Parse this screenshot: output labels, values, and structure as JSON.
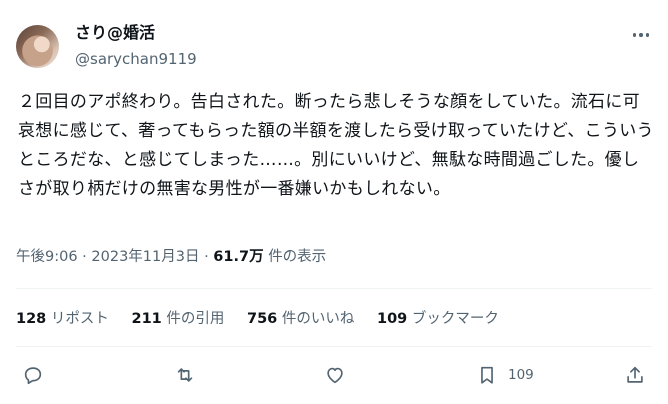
{
  "user": {
    "display_name": "さり@婚活",
    "handle": "@sarychan9119"
  },
  "tweet": {
    "text": "２回目のアポ終わり。告白された。断ったら悲しそうな顔をしていた。流石に可哀想に感じて、奢ってもらった額の半額を渡したら受け取っていたけど、こういうところだな、と感じてしまった……。別にいいけど、無駄な時間過ごした。優しさが取り柄だけの無害な男性が一番嫌いかもしれない。"
  },
  "meta": {
    "time": "午後9:06",
    "sep1": "·",
    "date": "2023年11月3日",
    "sep2": "·",
    "views": "61.7万",
    "views_label": "件の表示"
  },
  "stats": {
    "reposts_count": "128",
    "reposts_label": "リポスト",
    "quotes_count": "211",
    "quotes_label": "件の引用",
    "likes_count": "756",
    "likes_label": "件のいいね",
    "bookmarks_count": "109",
    "bookmarks_label": "ブックマーク"
  },
  "actions": {
    "reply_icon": "reply-icon",
    "repost_icon": "repost-icon",
    "like_icon": "heart-icon",
    "bookmark_icon": "bookmark-icon",
    "bookmark_count": "109",
    "share_icon": "share-icon"
  },
  "colors": {
    "text": "#0f1419",
    "secondary": "#536471",
    "divider": "#eff3f4"
  }
}
